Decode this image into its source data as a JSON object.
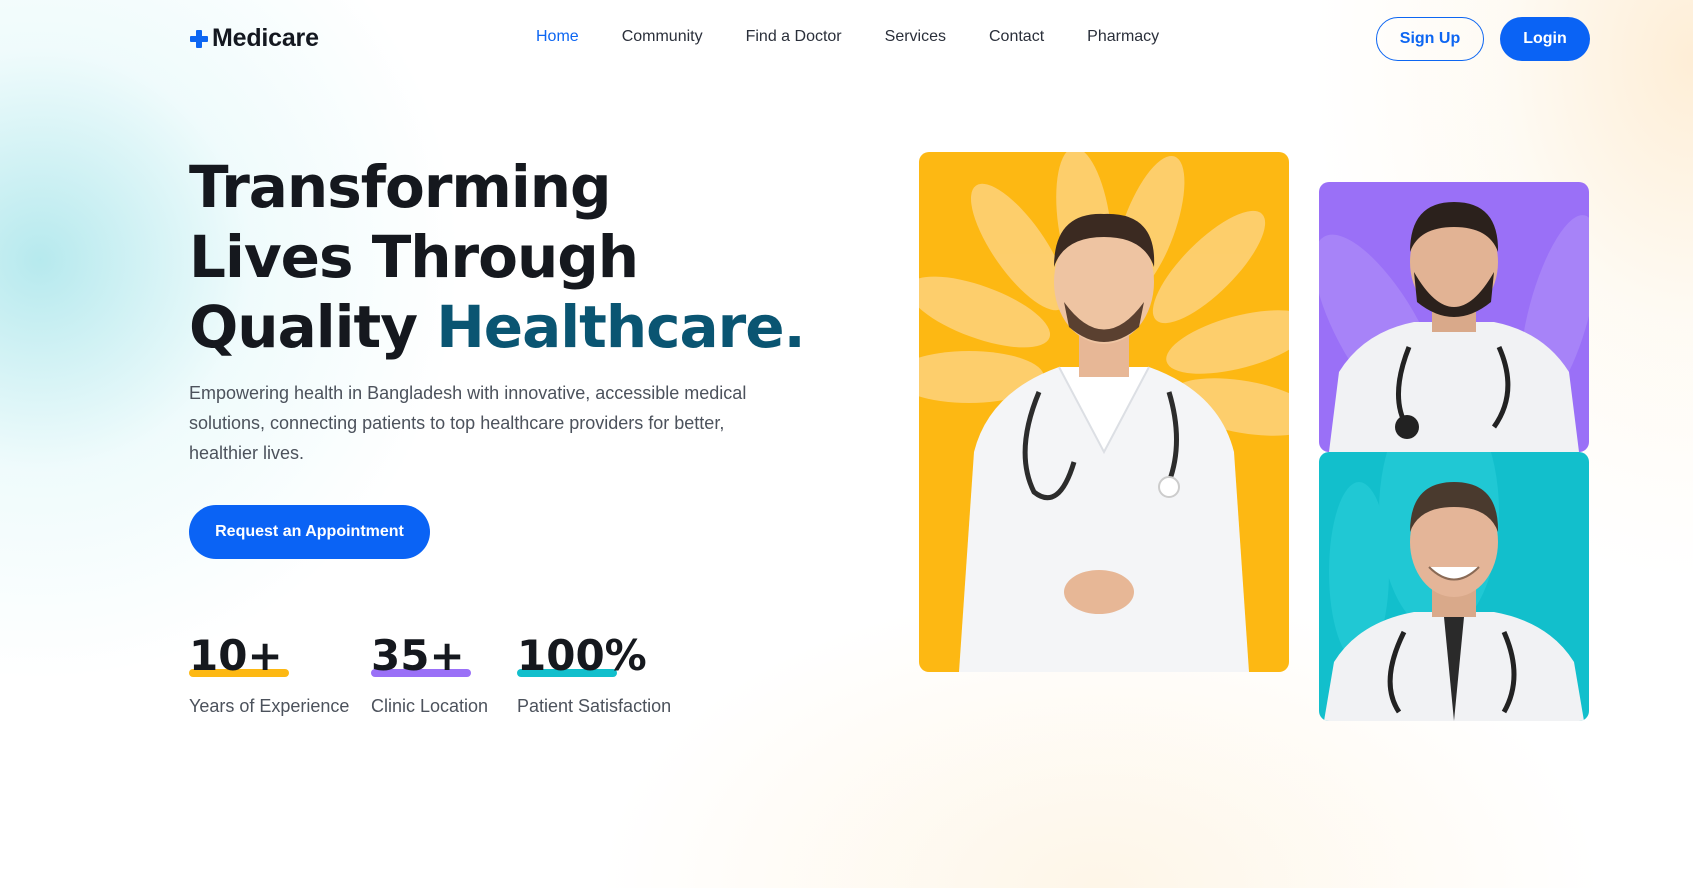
{
  "brand": {
    "name": "Medicare",
    "logo_icon": "plus-icon",
    "accent": "#0d66f2"
  },
  "nav": {
    "items": [
      {
        "label": "Home",
        "active": true
      },
      {
        "label": "Community"
      },
      {
        "label": "Find a Doctor"
      },
      {
        "label": "Services"
      },
      {
        "label": "Contact"
      },
      {
        "label": "Pharmacy"
      }
    ],
    "signup_label": "Sign Up",
    "login_label": "Login"
  },
  "hero": {
    "title_line1": "Transforming",
    "title_line2": "Lives Through",
    "title_line3_plain": "Quality ",
    "title_line3_accent": "Healthcare.",
    "subtitle": "Empowering health in Bangladesh with innovative, accessible medical solutions, connecting patients to top healthcare providers for better, healthier lives.",
    "cta_label": "Request an Appointment"
  },
  "stats": [
    {
      "value": "10+",
      "label": "Years of Experience",
      "bar_color": "#fdb813"
    },
    {
      "value": "35+",
      "label": "Clinic Location",
      "bar_color": "#9a70f7"
    },
    {
      "value": "100%",
      "label": "Patient Satisfaction",
      "bar_color": "#12bfcc"
    }
  ],
  "images": {
    "card1_color": "#fdb813",
    "card2_color": "#9a70f7",
    "card3_color": "#12bfcc"
  }
}
